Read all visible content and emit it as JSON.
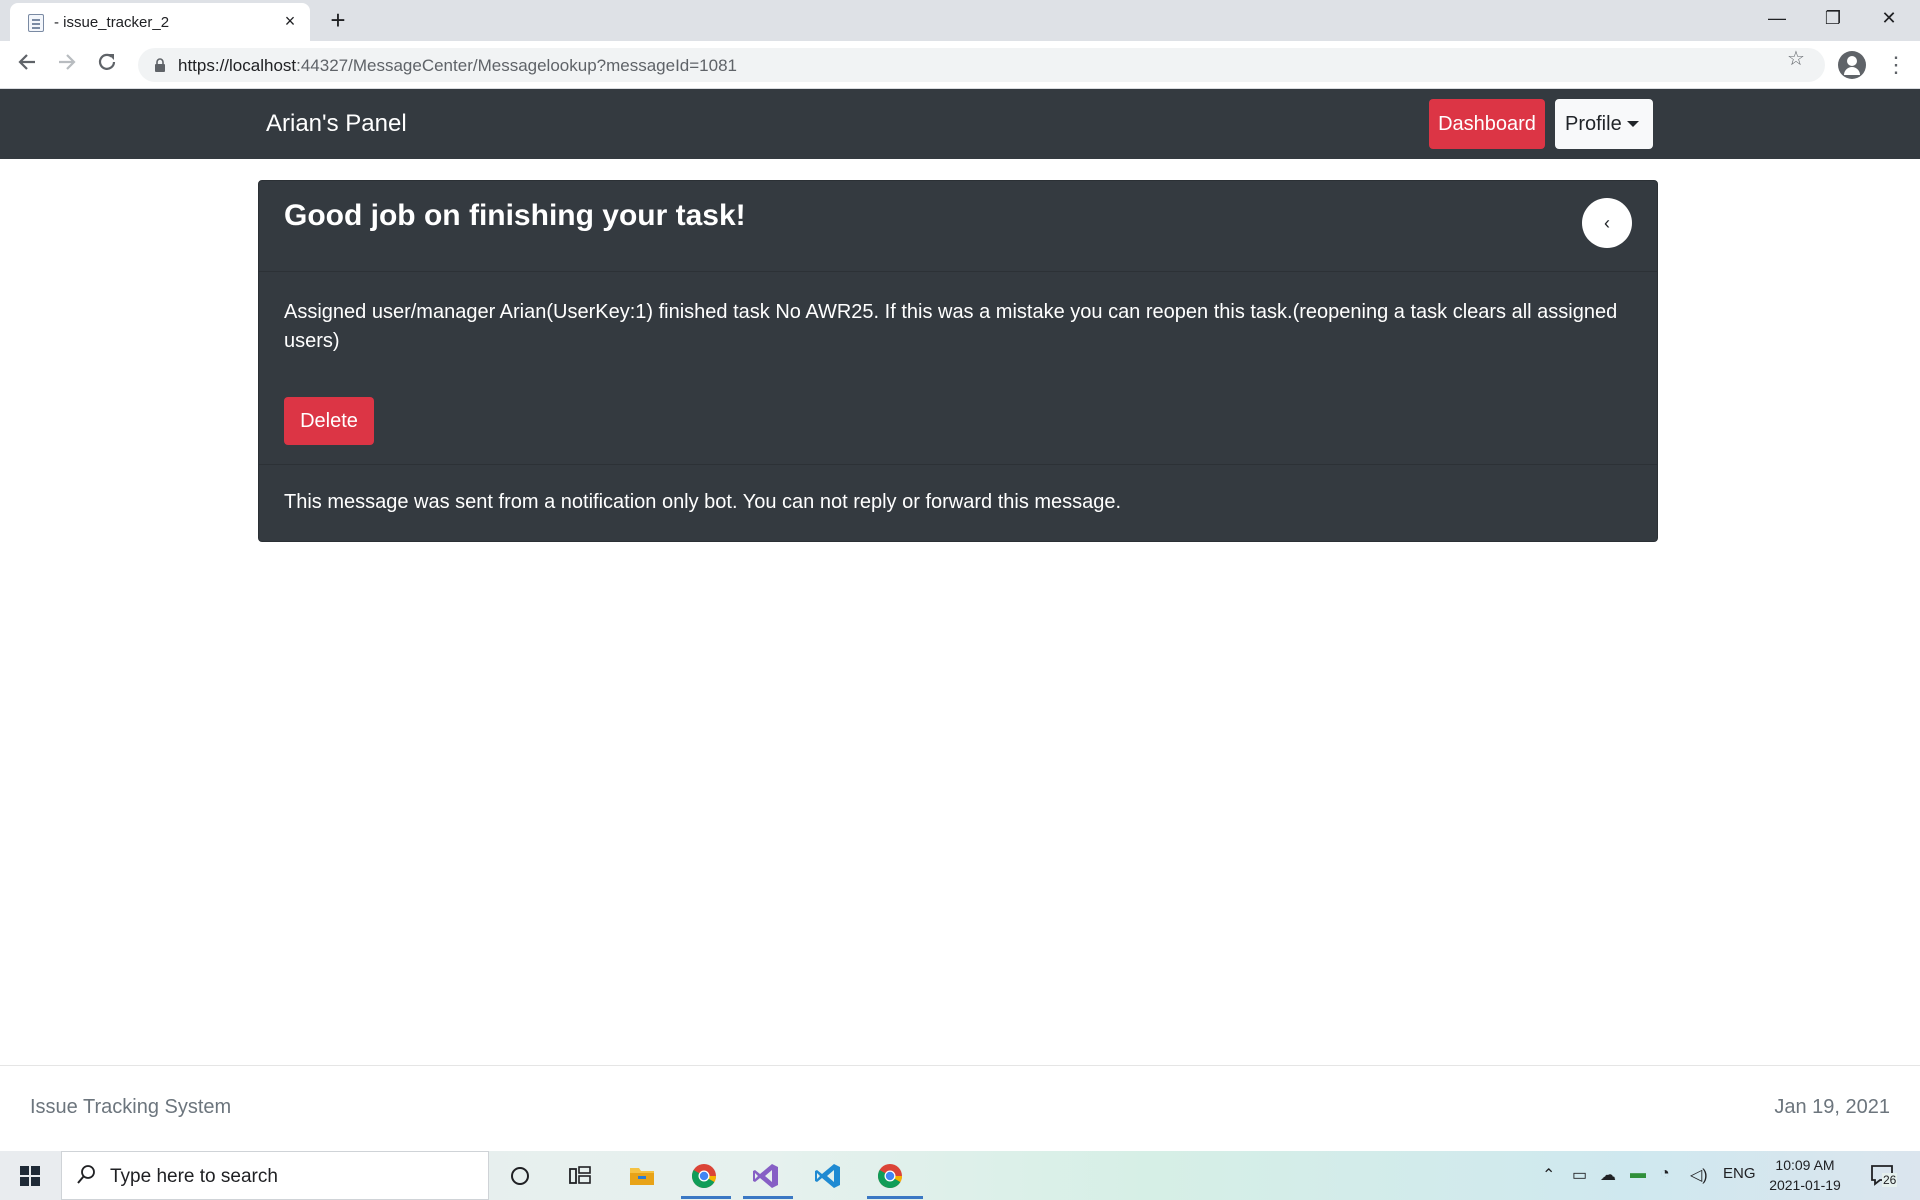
{
  "browser": {
    "tab_title": "- issue_tracker_2",
    "url_host": "https://localhost",
    "url_rest": ":44327/MessageCenter/Messagelookup?messageId=1081",
    "tab_close": "×",
    "new_tab": "+",
    "win_minimize": "—",
    "win_restore": "❐",
    "win_close": "✕"
  },
  "navbar": {
    "brand": "Arian's Panel",
    "dashboard_label": "Dashboard",
    "profile_label": "Profile"
  },
  "message": {
    "title": "Good job on finishing your task!",
    "back_label": "‹",
    "body": "Assigned user/manager Arian(UserKey:1) finished task No AWR25. If this was a mistake you can reopen this task.(reopening a task clears all assigned users)",
    "delete_label": "Delete",
    "footer_note": "This message was sent from a notification only bot. You can not reply or forward this message."
  },
  "footer": {
    "left": "Issue Tracking System",
    "right": "Jan 19, 2021"
  },
  "taskbar": {
    "search_placeholder": "Type here to search",
    "language": "ENG",
    "time": "10:09 AM",
    "date": "2021-01-19",
    "notification_count": "26"
  },
  "colors": {
    "navbar_bg": "#343a40",
    "danger": "#dc3545",
    "light": "#f8f9fa"
  },
  "icons": [
    "back-arrow-icon",
    "forward-arrow-icon",
    "reload-icon",
    "lock-icon",
    "star-icon",
    "account-icon",
    "kebab-menu-icon",
    "windows-start-icon",
    "search-icon",
    "cortana-icon",
    "task-view-icon",
    "file-explorer-icon",
    "chrome-icon",
    "visual-studio-icon",
    "vscode-icon"
  ]
}
